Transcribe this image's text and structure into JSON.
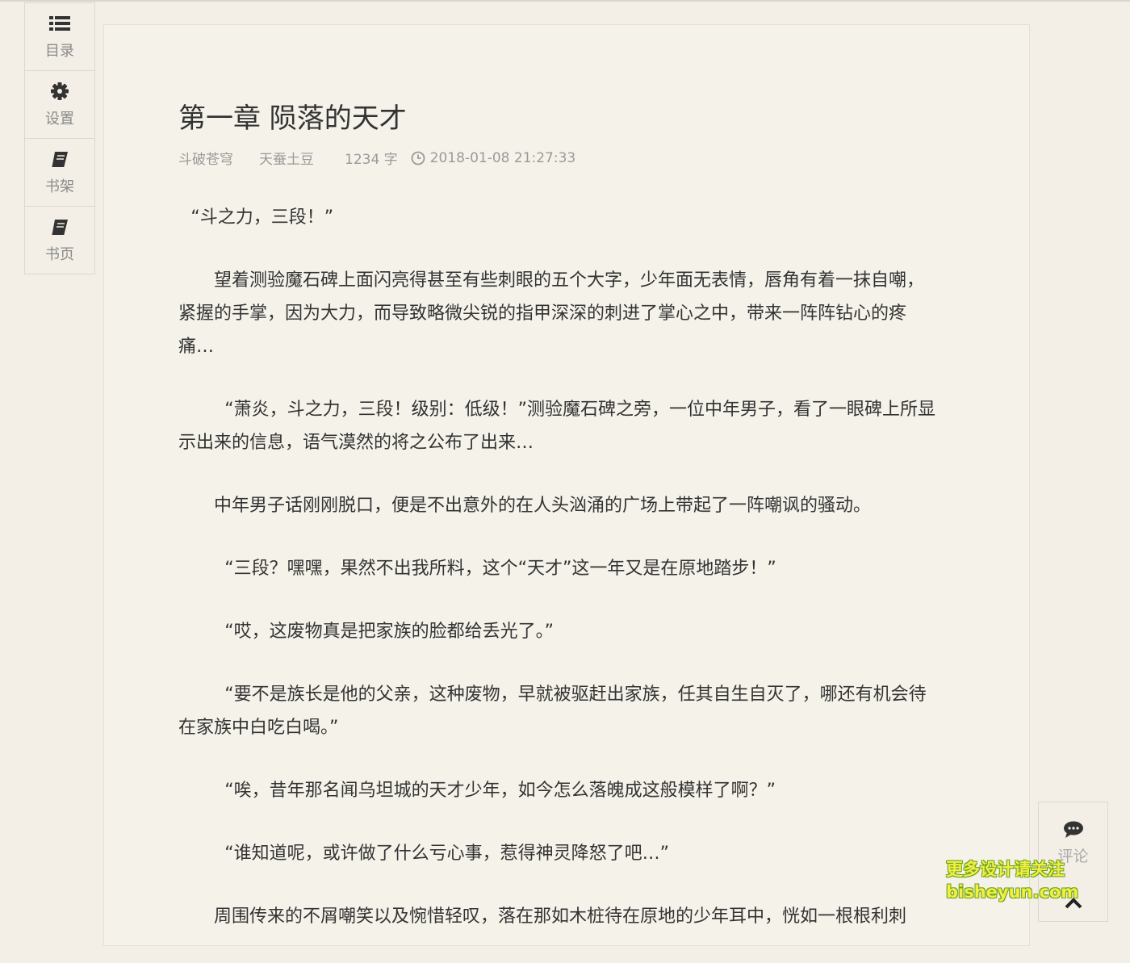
{
  "sidebar": {
    "items": [
      {
        "label": "目录",
        "icon": "list-icon"
      },
      {
        "label": "设置",
        "icon": "gear-icon"
      },
      {
        "label": "书架",
        "icon": "book-icon"
      },
      {
        "label": "书页",
        "icon": "book-icon"
      }
    ]
  },
  "chapter": {
    "title": "第一章 陨落的天才",
    "book": "斗破苍穹",
    "author": "天蚕土豆",
    "word_count": "1234 字",
    "datetime": "2018-01-08 21:27:33",
    "paragraphs": [
      "“斗之力，三段！”",
      "望着测验魔石碑上面闪亮得甚至有些刺眼的五个大字，少年面无表情，唇角有着一抹自嘲，紧握的手掌，因为大力，而导致略微尖锐的指甲深深的刺进了掌心之中，带来一阵阵钻心的疼痛…",
      "“萧炎，斗之力，三段！级别：低级！”测验魔石碑之旁，一位中年男子，看了一眼碑上所显示出来的信息，语气漠然的将之公布了出来…",
      "中年男子话刚刚脱口，便是不出意外的在人头汹涌的广场上带起了一阵嘲讽的骚动。",
      "“三段？嘿嘿，果然不出我所料，这个“天才”这一年又是在原地踏步！”",
      "“哎，这废物真是把家族的脸都给丢光了。”",
      "“要不是族长是他的父亲，这种废物，早就被驱赶出家族，任其自生自灭了，哪还有机会待在家族中白吃白喝。”",
      "“唉，昔年那名闻乌坦城的天才少年，如今怎么落魄成这般模样了啊？”",
      "“谁知道呢，或许做了什么亏心事，惹得神灵降怒了吧…”",
      "周围传来的不屑嘲笑以及惋惜轻叹，落在那如木桩待在原地的少年耳中，恍如一根根利刺"
    ]
  },
  "rightbar": {
    "comment_label": "评论",
    "comment_icon": "comment-icon",
    "top_icon": "chevron-up-icon"
  },
  "watermark": {
    "line1": "更多设计请关注",
    "line2": "bisheyun.com"
  }
}
